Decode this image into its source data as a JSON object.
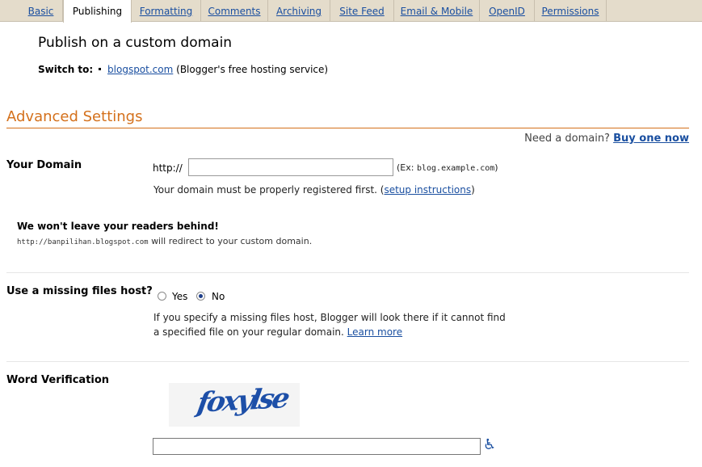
{
  "tabs": [
    {
      "label": "Basic",
      "active": false
    },
    {
      "label": "Publishing",
      "active": true
    },
    {
      "label": "Formatting",
      "active": false
    },
    {
      "label": "Comments",
      "active": false
    },
    {
      "label": "Archiving",
      "active": false
    },
    {
      "label": "Site Feed",
      "active": false
    },
    {
      "label": "Email & Mobile",
      "active": false
    },
    {
      "label": "OpenID",
      "active": false
    },
    {
      "label": "Permissions",
      "active": false
    }
  ],
  "publish": {
    "title": "Publish on a custom domain",
    "switch_label": "Switch to:",
    "switch_link": "blogspot.com",
    "switch_desc": "(Blogger's free hosting service)"
  },
  "advanced": {
    "title": "Advanced Settings",
    "need_domain_text": "Need a domain?",
    "buy_link": "Buy one now"
  },
  "domain": {
    "label": "Your Domain",
    "prefix": "http://",
    "value": "",
    "example_prefix": "(Ex:",
    "example_code": "blog.example.com",
    "example_suffix": ")",
    "note_text": "Your domain must be properly registered first. (",
    "note_link": "setup instructions",
    "note_suffix": ")"
  },
  "readers": {
    "title": "We won't leave your readers behind!",
    "url": "http://banpilihan.blogspot.com",
    "desc": "will redirect to your custom domain."
  },
  "missing_host": {
    "label": "Use a missing files host?",
    "options": [
      {
        "label": "Yes",
        "checked": false
      },
      {
        "label": "No",
        "checked": true
      }
    ],
    "desc": "If you specify a missing files host, Blogger will look there if it cannot find a specified file on your regular domain.",
    "learn_more": "Learn more"
  },
  "word_verification": {
    "label": "Word Verification",
    "captcha_text": "foxylse",
    "value": "",
    "accessibility_icon": "wheelchair-icon"
  }
}
